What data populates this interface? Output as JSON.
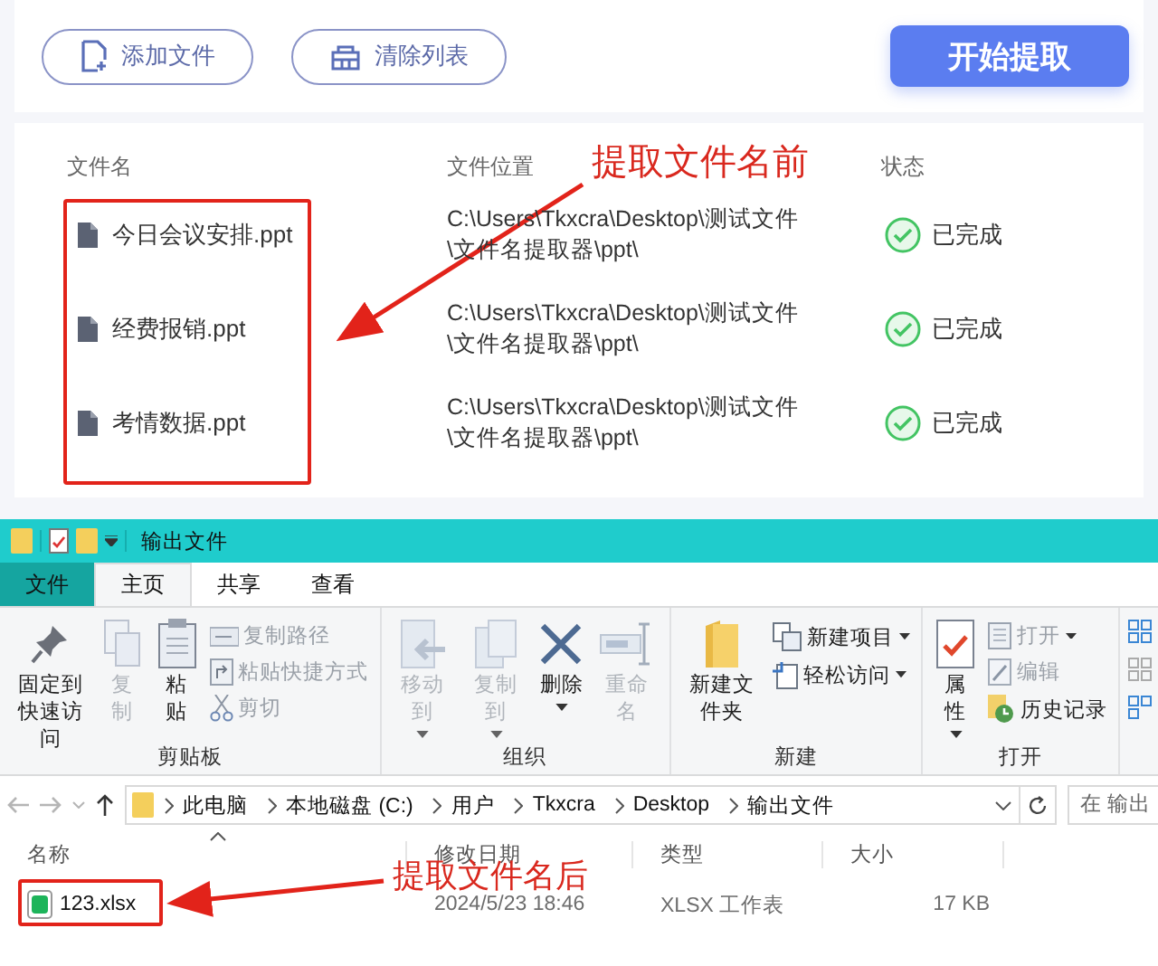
{
  "extractor": {
    "buttons": [
      {
        "kind": "add",
        "label": "添加文件"
      },
      {
        "kind": "clear",
        "label": "清除列表"
      }
    ],
    "start_button": "开始提取",
    "columns": [
      "文件名",
      "文件位置",
      "状态"
    ],
    "rows": [
      {
        "name": "今日会议安排.ppt",
        "location": [
          "C:\\Users\\Tkxcra\\Desktop\\测试文件",
          "\\文件名提取器\\ppt\\"
        ],
        "status": "已完成",
        "done": true
      },
      {
        "name": "经费报销.ppt",
        "location": [
          "C:\\Users\\Tkxcra\\Desktop\\测试文件",
          "\\文件名提取器\\ppt\\"
        ],
        "status": "已完成",
        "done": true
      },
      {
        "name": "考情数据.ppt",
        "location": [
          "C:\\Users\\Tkxcra\\Desktop\\测试文件",
          "\\文件名提取器\\ppt\\"
        ],
        "status": "已完成",
        "done": true
      }
    ]
  },
  "explorer": {
    "title": "输出文件",
    "tabs": [
      {
        "label": "文件",
        "kind": "file",
        "selected": false
      },
      {
        "label": "主页",
        "kind": "tab",
        "selected": true
      },
      {
        "label": "共享",
        "kind": "tab",
        "selected": false
      },
      {
        "label": "查看",
        "kind": "tab",
        "selected": false
      }
    ],
    "ribbon_groups": [
      {
        "label": "剪贴板",
        "items": [
          {
            "kind": "large",
            "label": "固定到快速访问",
            "disabled": false
          },
          {
            "kind": "large",
            "label": "复制",
            "disabled": true
          },
          {
            "kind": "large",
            "label": "粘贴",
            "disabled": false
          },
          {
            "kind": "small",
            "label": "复制路径",
            "disabled": true
          },
          {
            "kind": "small",
            "label": "粘贴快捷方式",
            "disabled": true
          },
          {
            "kind": "small",
            "label": "剪切",
            "disabled": true
          }
        ]
      },
      {
        "label": "组织",
        "items": [
          {
            "kind": "large",
            "label": "移动到",
            "disabled": true,
            "dropdown": true
          },
          {
            "kind": "large",
            "label": "复制到",
            "disabled": true,
            "dropdown": true
          },
          {
            "kind": "large",
            "label": "删除",
            "disabled": false,
            "dropdown": true
          },
          {
            "kind": "large",
            "label": "重命名",
            "disabled": true
          }
        ]
      },
      {
        "label": "新建",
        "items": [
          {
            "kind": "large",
            "label": "新建文件夹",
            "disabled": false
          },
          {
            "kind": "small",
            "label": "新建项目",
            "disabled": false,
            "dropdown": true
          },
          {
            "kind": "small",
            "label": "轻松访问",
            "disabled": false,
            "dropdown": true
          }
        ]
      },
      {
        "label": "打开",
        "items": [
          {
            "kind": "large",
            "label": "属性",
            "disabled": false,
            "dropdown": true
          },
          {
            "kind": "small",
            "label": "打开",
            "disabled": true,
            "dropdown": true
          },
          {
            "kind": "small",
            "label": "编辑",
            "disabled": true
          },
          {
            "kind": "small",
            "label": "历史记录",
            "disabled": false
          }
        ]
      }
    ],
    "breadcrumb": [
      "此电脑",
      "本地磁盘 (C:)",
      "用户",
      "Tkxcra",
      "Desktop",
      "输出文件"
    ],
    "search": {
      "placeholder": "在 输出"
    },
    "columns": [
      "名称",
      "修改日期",
      "类型",
      "大小"
    ],
    "files": [
      {
        "name": "123.xlsx",
        "modified": "2024/5/23 18:46",
        "type": "XLSX 工作表",
        "size": "17 KB"
      }
    ]
  },
  "annotations": [
    {
      "text": "提取文件名前"
    },
    {
      "text": "提取文件名后"
    }
  ]
}
